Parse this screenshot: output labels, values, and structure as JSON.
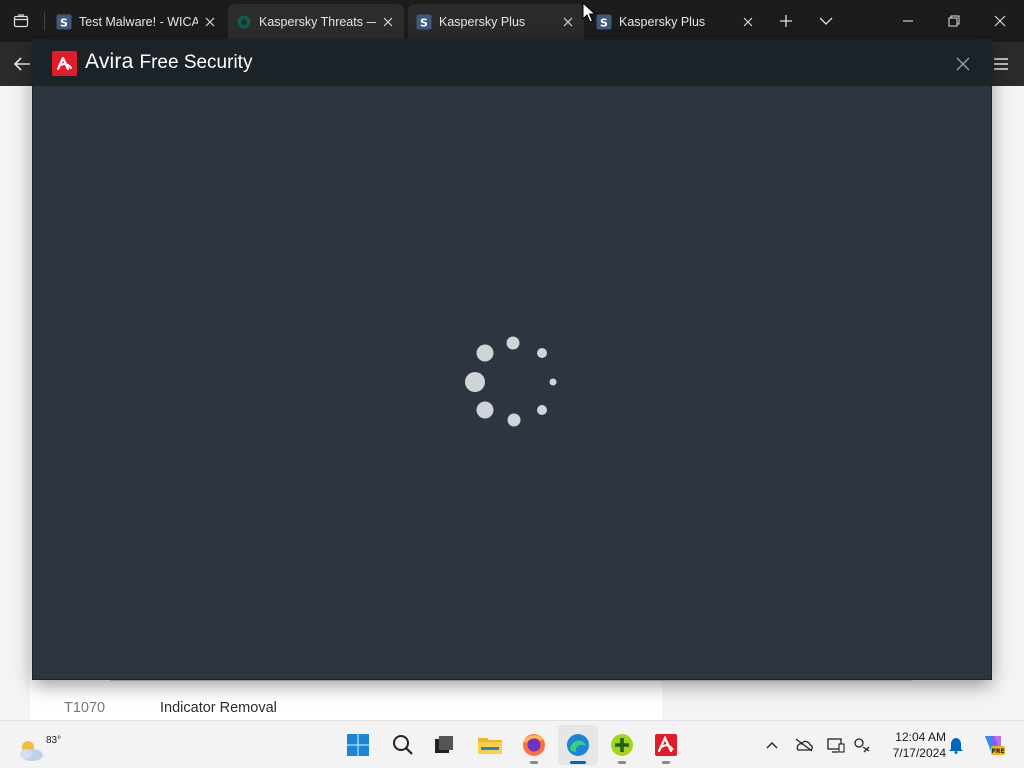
{
  "browser": {
    "tabs": [
      {
        "title": "Test Malware! - WICAR",
        "favicon": "s-site-icon",
        "active": false
      },
      {
        "title": "Kaspersky Threats — T",
        "favicon": "kaspersky-icon",
        "active": true
      },
      {
        "title": "Kaspersky Plus",
        "favicon": "s-site-icon",
        "active": false
      },
      {
        "title": "Kaspersky Plus",
        "favicon": "s-site-icon",
        "active": false
      }
    ],
    "buttons": {
      "tab_actions": "tab-actions-icon",
      "new_tab": "plus-icon",
      "tab_list": "chevron-down-icon",
      "minimize": "minimize-icon",
      "restore": "restore-icon",
      "close": "close-icon",
      "back": "back-arrow-icon",
      "menu": "hamburger-menu-icon"
    }
  },
  "webpage": {
    "row": {
      "id": "T1070",
      "name": "Indicator Removal"
    }
  },
  "avira": {
    "brand": "Avira",
    "product": "Free Security",
    "state": "loading",
    "accent_color": "#e21c2a",
    "background_color": "#2d3640"
  },
  "taskbar": {
    "weather_temp": "83°",
    "apps": [
      "windows-start-icon",
      "search-icon",
      "task-view-icon",
      "file-explorer-icon",
      "firefox-icon",
      "edge-browser-icon",
      "xbox-gamebar-icon",
      "avira-icon"
    ],
    "clock": {
      "time": "12:04 AM",
      "date": "7/17/2024"
    },
    "tray": [
      "chevron-up-icon",
      "onedrive-icon",
      "display-icon",
      "network-icon",
      "notification-bell-icon",
      "copilot-icon"
    ]
  }
}
